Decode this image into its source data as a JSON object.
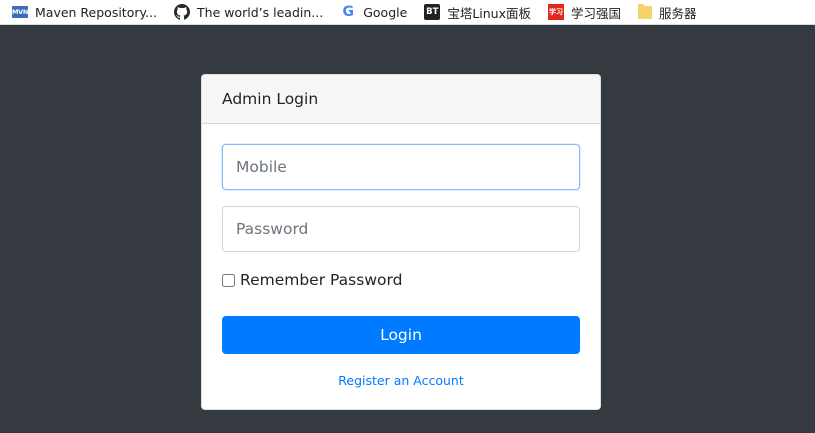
{
  "bookmarks": [
    {
      "icon": "maven-icon",
      "icon_text": "MVN",
      "label": "Maven Repository..."
    },
    {
      "icon": "github-icon",
      "label": "The world’s leadin..."
    },
    {
      "icon": "google-icon",
      "icon_text": "G",
      "label": "Google"
    },
    {
      "icon": "bt-panel-icon",
      "icon_text": "BT",
      "label": "宝塔Linux面板"
    },
    {
      "icon": "xuexi-icon",
      "icon_text": "学习",
      "label": "学习强国"
    },
    {
      "icon": "folder-icon",
      "label": "服务器"
    }
  ],
  "login": {
    "title": "Admin Login",
    "mobile_placeholder": "Mobile",
    "password_placeholder": "Password",
    "remember_label": "Remember Password",
    "remember_checked": false,
    "submit_label": "Login",
    "register_link": "Register an Account"
  },
  "colors": {
    "page_background": "#343a40",
    "primary": "#007bff",
    "card_header": "#f7f7f7"
  }
}
